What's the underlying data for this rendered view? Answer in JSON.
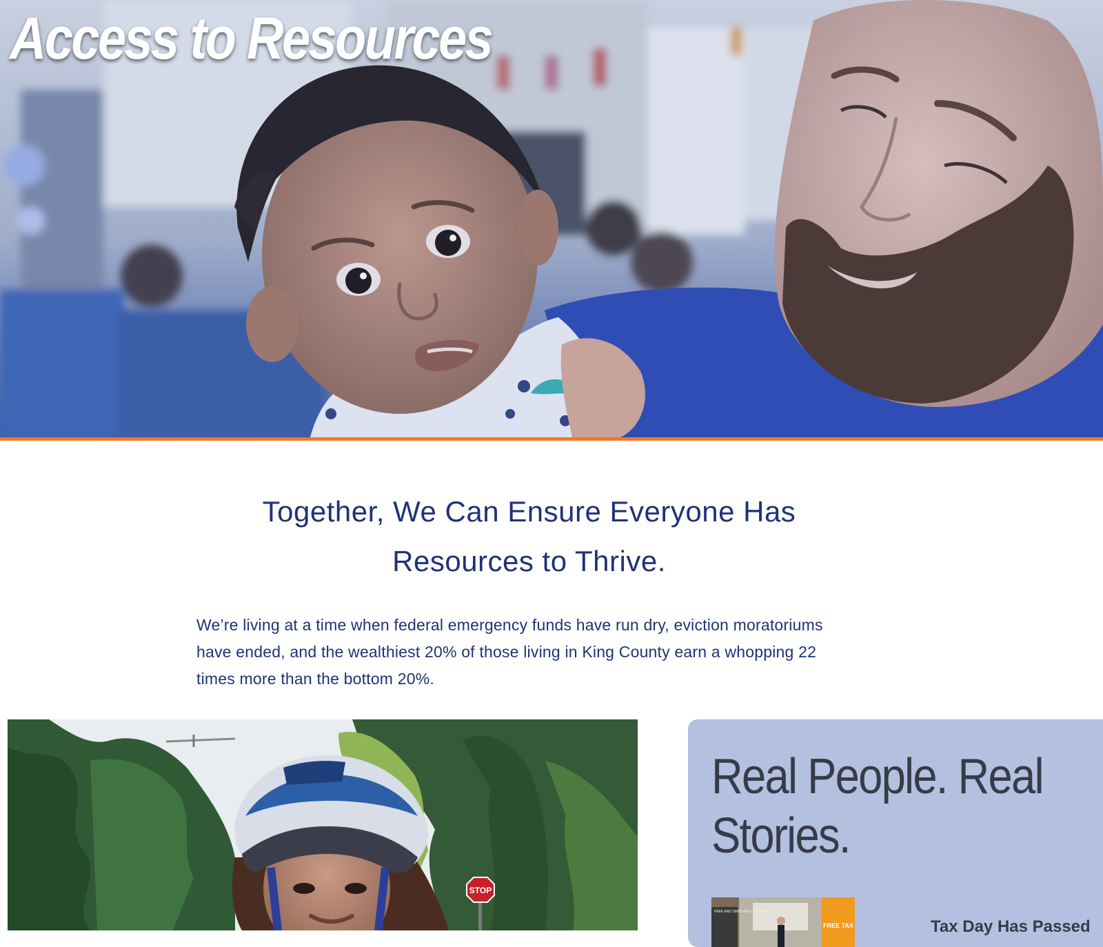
{
  "hero": {
    "title": "Access to Resources",
    "accent_rule_color": "#f07a22"
  },
  "intro": {
    "heading": "Together, We Can Ensure Everyone Has Resources to Thrive.",
    "body": "We’re living at a time when federal emergency funds have run dry, eviction moratoriums have ended, and the wealthiest 20% of those living in King County earn a whopping 22 times more than the bottom 20%."
  },
  "stories": {
    "title": "Real People. Real Stories.",
    "items": [
      {
        "title": "Tax Day Has Passed",
        "thumb_text_left": "FREE AND SIMPLIFIED TAX FILING",
        "thumb_text_right": "FREE TAX"
      }
    ]
  },
  "kid_photo": {
    "sign_text": "STOP"
  },
  "colors": {
    "navy": "#1f3275",
    "card_bg": "#b4c0e0",
    "card_text": "#363b47",
    "orange": "#f07a22"
  }
}
